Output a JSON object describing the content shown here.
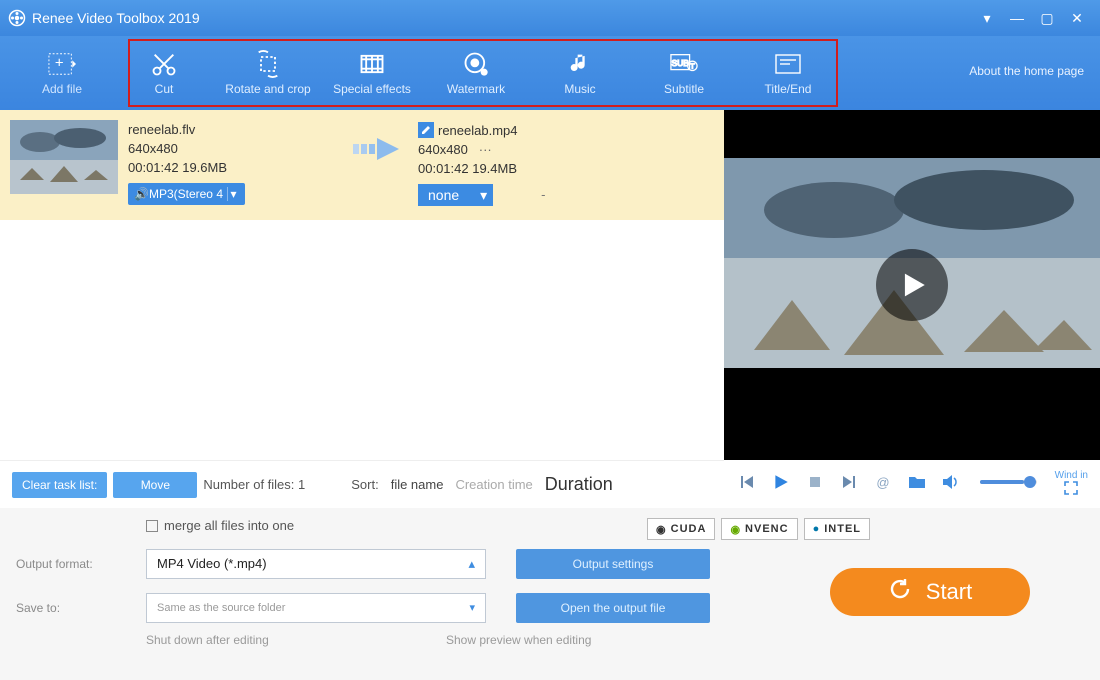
{
  "window": {
    "title": "Renee Video Toolbox 2019"
  },
  "toolbar": {
    "add_file": "Add file",
    "items": [
      {
        "label": "Cut"
      },
      {
        "label": "Rotate and crop"
      },
      {
        "label": "Special effects"
      },
      {
        "label": "Watermark"
      },
      {
        "label": "Music"
      },
      {
        "label": "Subtitle"
      },
      {
        "label": "Title/End"
      }
    ],
    "about": "About the home page"
  },
  "task": {
    "src_name": "reneelab.flv",
    "src_res": "640x480",
    "src_meta": "00:01:42  19.6MB",
    "dst_name": "reneelab.mp4",
    "dst_res": "640x480",
    "dst_res_more": "···",
    "dst_meta": "00:01:42  19.4MB",
    "audio_chip": "MP3(Stereo 4",
    "subtitle_chip": "none",
    "dash": "-"
  },
  "mid": {
    "clear": "Clear task list:",
    "move": "Move",
    "files_label": "Number of files: 1",
    "sort_label": "Sort:",
    "sort_name": "file name",
    "sort_time": "Creation time",
    "sort_duration": "Duration"
  },
  "player": {
    "windin": "Wind in"
  },
  "settings": {
    "merge": "merge all files into one",
    "gpu": [
      "CUDA",
      "NVENC",
      "INTEL"
    ],
    "out_label": "Output format:",
    "out_value": "MP4 Video (*.mp4)",
    "out_settings_btn": "Output settings",
    "dest_value": "Same as the source folder",
    "dest_btn": "Open the output file",
    "save_label": "Save to:",
    "shutdown": "Shut down after editing",
    "preview": "Show preview when editing",
    "start": "Start"
  }
}
